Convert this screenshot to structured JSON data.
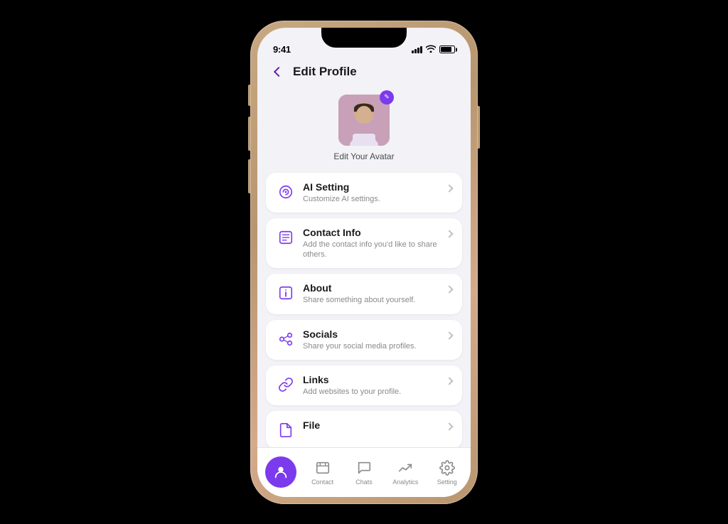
{
  "status_bar": {
    "time": "9:41"
  },
  "header": {
    "title": "Edit Profile",
    "back_label": "back"
  },
  "avatar": {
    "label": "Edit Your Avatar"
  },
  "menu_items": [
    {
      "id": "ai-setting",
      "title": "AI Setting",
      "subtitle": "Customize AI settings.",
      "icon": "ai"
    },
    {
      "id": "contact-info",
      "title": "Contact Info",
      "subtitle": "Add the contact info you'd like to share others.",
      "icon": "contact"
    },
    {
      "id": "about",
      "title": "About",
      "subtitle": "Share something about yourself.",
      "icon": "info"
    },
    {
      "id": "socials",
      "title": "Socials",
      "subtitle": "Share your social media profiles.",
      "icon": "socials"
    },
    {
      "id": "links",
      "title": "Links",
      "subtitle": "Add websites to your profile.",
      "icon": "links"
    },
    {
      "id": "file",
      "title": "File",
      "subtitle": "",
      "icon": "file"
    }
  ],
  "bottom_nav": {
    "items": [
      {
        "id": "profile",
        "label": "",
        "active": true
      },
      {
        "id": "contact",
        "label": "Contact",
        "active": false
      },
      {
        "id": "chats",
        "label": "Chats",
        "active": false
      },
      {
        "id": "analytics",
        "label": "Analytics",
        "active": false
      },
      {
        "id": "setting",
        "label": "Setting",
        "active": false
      }
    ]
  },
  "colors": {
    "primary": "#7c3aed",
    "text_primary": "#1a1a1a",
    "text_secondary": "#8a8a8e"
  }
}
